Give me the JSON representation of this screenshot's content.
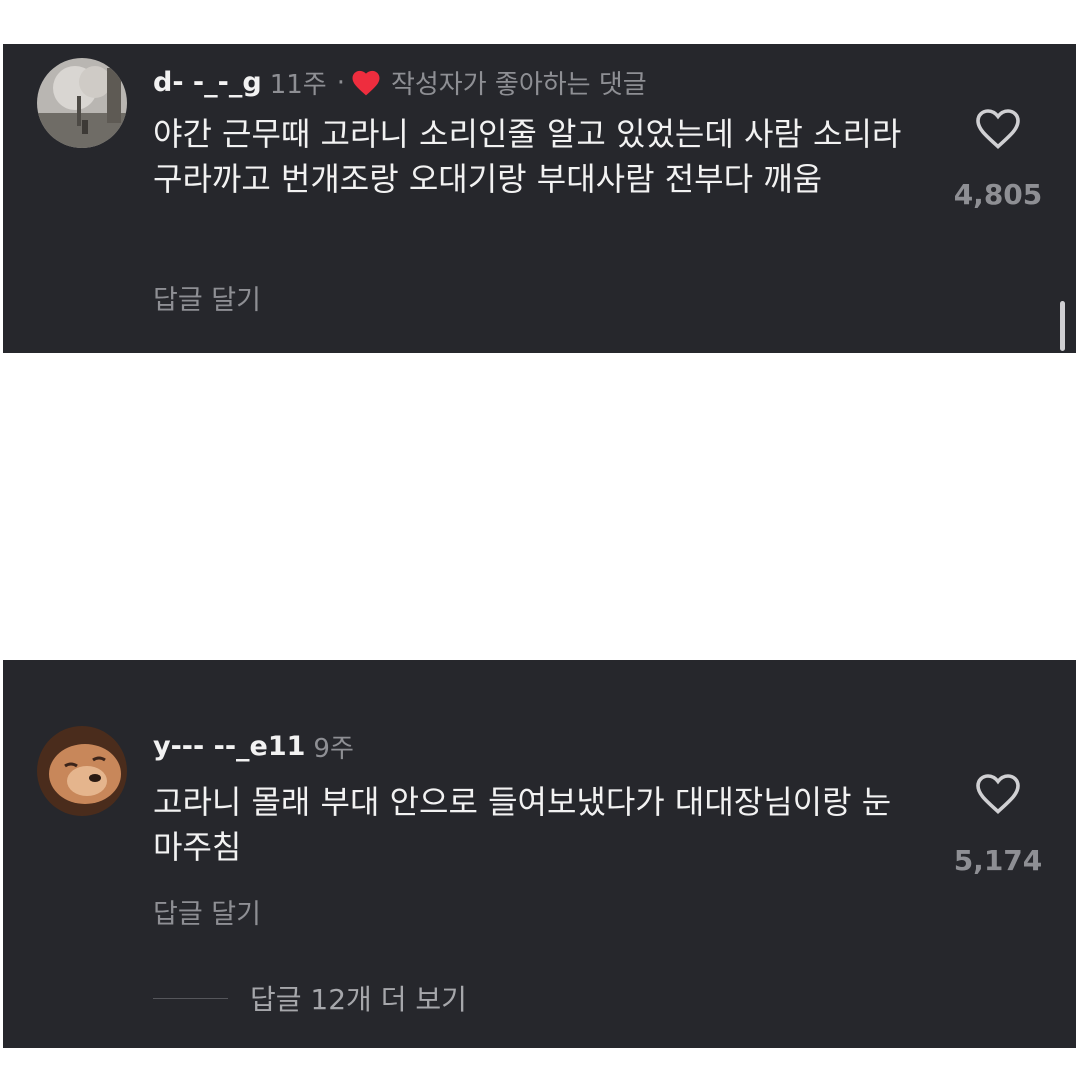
{
  "comments": [
    {
      "username": "d- -_-_g",
      "time": "11주",
      "separator": "·",
      "creator_liked_label": "작성자가 좋아하는 댓글",
      "text": "야간 근무때 고라니 소리인줄 알고 있었는데 사람 소리라 구라까고 번개조랑 오대기랑 부대사람 전부다 깨움",
      "reply_label": "답글 달기",
      "like_count": "4,805",
      "avatar_icon": "cherry-blossom-photo-avatar",
      "like_icon": "heart-outline-icon"
    },
    {
      "username": "y--- --_e11",
      "time": "9주",
      "text": "고라니 몰래 부대 안으로 들여보냈다가 대대장님이랑 눈 마주침",
      "reply_label": "답글 달기",
      "like_count": "5,174",
      "more_replies_label": "답글 12개 더 보기",
      "avatar_icon": "dog-photo-avatar",
      "like_icon": "heart-outline-icon"
    }
  ],
  "colors": {
    "panel_bg": "#26272c",
    "text_primary": "#f2f2f2",
    "text_secondary": "#8e8f94",
    "heart_red": "#ee2d3e"
  }
}
